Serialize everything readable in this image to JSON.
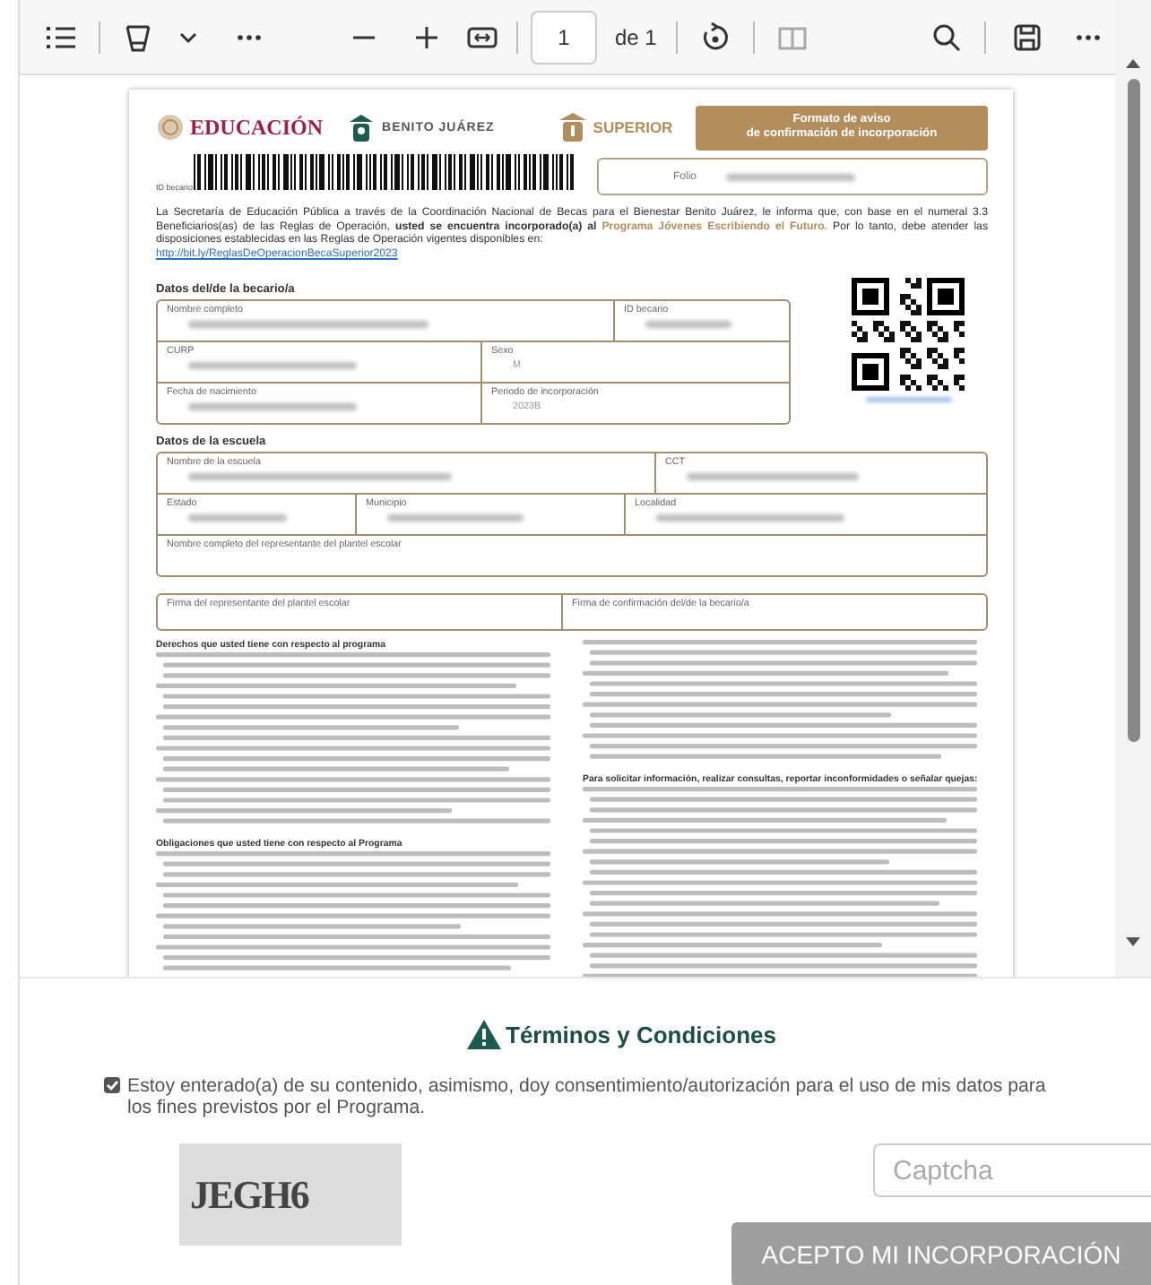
{
  "toolbar": {
    "page_number": "1",
    "page_total": "de 1"
  },
  "document": {
    "logo_educacion": "EDUCACIÓN",
    "logo_becas": "BENITO JUÁREZ",
    "logo_beca": "SUPERIOR",
    "title_lines": [
      "Formato de aviso",
      "de confirmación de incorporación"
    ],
    "barcode_label": "ID becario",
    "folio": {
      "label": "Folio",
      "redacted": true
    },
    "intro": "La Secretaría de Educación Pública a través de la Coordinación Nacional de Becas para el Bienestar Benito Juárez, le informa que, con base en el numeral 3.3 Beneficiarios(as) de las Reglas de Operación, **usted se encuentra incorporado(a) al** **Programa Jóvenes Escribiendo el Futuro.** Por lo tanto, debe atender las disposiciones establecidas en las Reglas de Operación vigentes disponibles en:",
    "intro_link": "http://bit.ly/ReglasDeOperacionBecaSuperior2023",
    "becario": {
      "heading": "Datos del/de la becario/a",
      "rows": [
        [
          {
            "label": "Nombre completo",
            "redacted": true
          },
          {
            "label": "ID becario",
            "redacted": true
          }
        ],
        [
          {
            "label": "CURP",
            "redacted": true
          },
          {
            "label": "Sexo",
            "value": "M",
            "redacted": false
          }
        ],
        [
          {
            "label": "Fecha de nacimiento",
            "redacted": true
          },
          {
            "label": "Periodo de incorporación",
            "value": "2023B",
            "redacted": false
          }
        ]
      ]
    },
    "escuela": {
      "heading": "Datos de la escuela",
      "rows": [
        [
          {
            "label": "Nombre de la escuela",
            "redacted": true
          },
          {
            "label": "CCT",
            "redacted": true
          }
        ],
        [
          {
            "label": "Estado",
            "redacted": true
          },
          {
            "label": "Municipio",
            "redacted": true
          },
          {
            "label": "Localidad",
            "redacted": true
          }
        ],
        [
          {
            "label": "Nombre completo del representante del plantel escolar",
            "redacted": false
          }
        ]
      ]
    },
    "firmas": [
      "Firma del representante del plantel escolar",
      "Firma de confirmación del/de la becario/a"
    ],
    "left_sections": [
      {
        "heading": "Derechos que usted tiene con respecto al programa"
      },
      {
        "heading": "Obligaciones que usted tiene con respecto al Programa"
      }
    ],
    "right_sections": [
      {
        "heading": "Para solicitar información, realizar consultas, reportar inconformidades o señalar quejas:"
      }
    ]
  },
  "terms": {
    "heading": "Términos y Condiciones",
    "consent": {
      "text": "Estoy enterado(a) de su contenido, asimismo, doy consentimiento/autorización para el uso de mis datos para los fines previstos por el Programa.",
      "checked": true
    },
    "captcha_image": "JEGH6",
    "captcha_field": {
      "placeholder": "Captcha"
    },
    "submit": {
      "label": "ACEPTO MI INCORPORACIÓN",
      "disabled": true
    }
  }
}
